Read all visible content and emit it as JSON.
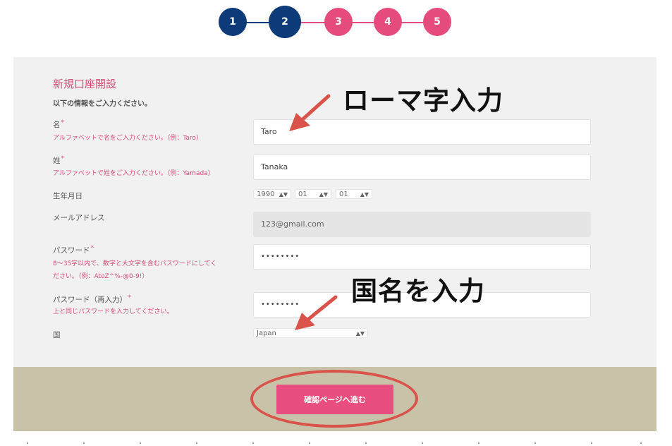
{
  "stepper": {
    "steps": [
      "1",
      "2",
      "3",
      "4",
      "5"
    ],
    "current_step": 2,
    "colors": {
      "done": "#0d3a78",
      "todo": "#e64b7d"
    }
  },
  "form": {
    "title": "新規口座開設",
    "subtitle": "以下の情報をご入力ください。",
    "first_name": {
      "label": "名",
      "required_mark": "*",
      "hint": "アルファベットで名をご入力ください。（例：Taro）",
      "value": "Taro"
    },
    "last_name": {
      "label": "姓",
      "required_mark": "*",
      "hint": "アルファベットで姓をご入力ください。（例：Yamada）",
      "value": "Tanaka"
    },
    "birthdate": {
      "label": "生年月日",
      "year": "1990",
      "month": "01",
      "day": "01"
    },
    "email": {
      "label": "メールアドレス",
      "value": "123@gmail.com"
    },
    "password": {
      "label": "パスワード",
      "required_mark": "*",
      "hint_line1": "8〜35字以内で、数字と大文字を含むパスワードにしてく",
      "hint_line2": "ださい。（例：AtoZ^%-@0-9!）",
      "value": "••••••••"
    },
    "password_confirm": {
      "label": "パスワード（再入力）",
      "required_mark": "*",
      "hint": "上と同じパスワードを入力してください。",
      "value": "••••••••"
    },
    "country": {
      "label": "国",
      "value": "Japan"
    }
  },
  "annotations": {
    "romaji": "ローマ字入力",
    "country": "国名を入力",
    "arrow_color": "#d9534a"
  },
  "footer": {
    "confirm_button": "確認ページへ進む",
    "accent": "#e84f80",
    "background": "#c8c2a8"
  }
}
